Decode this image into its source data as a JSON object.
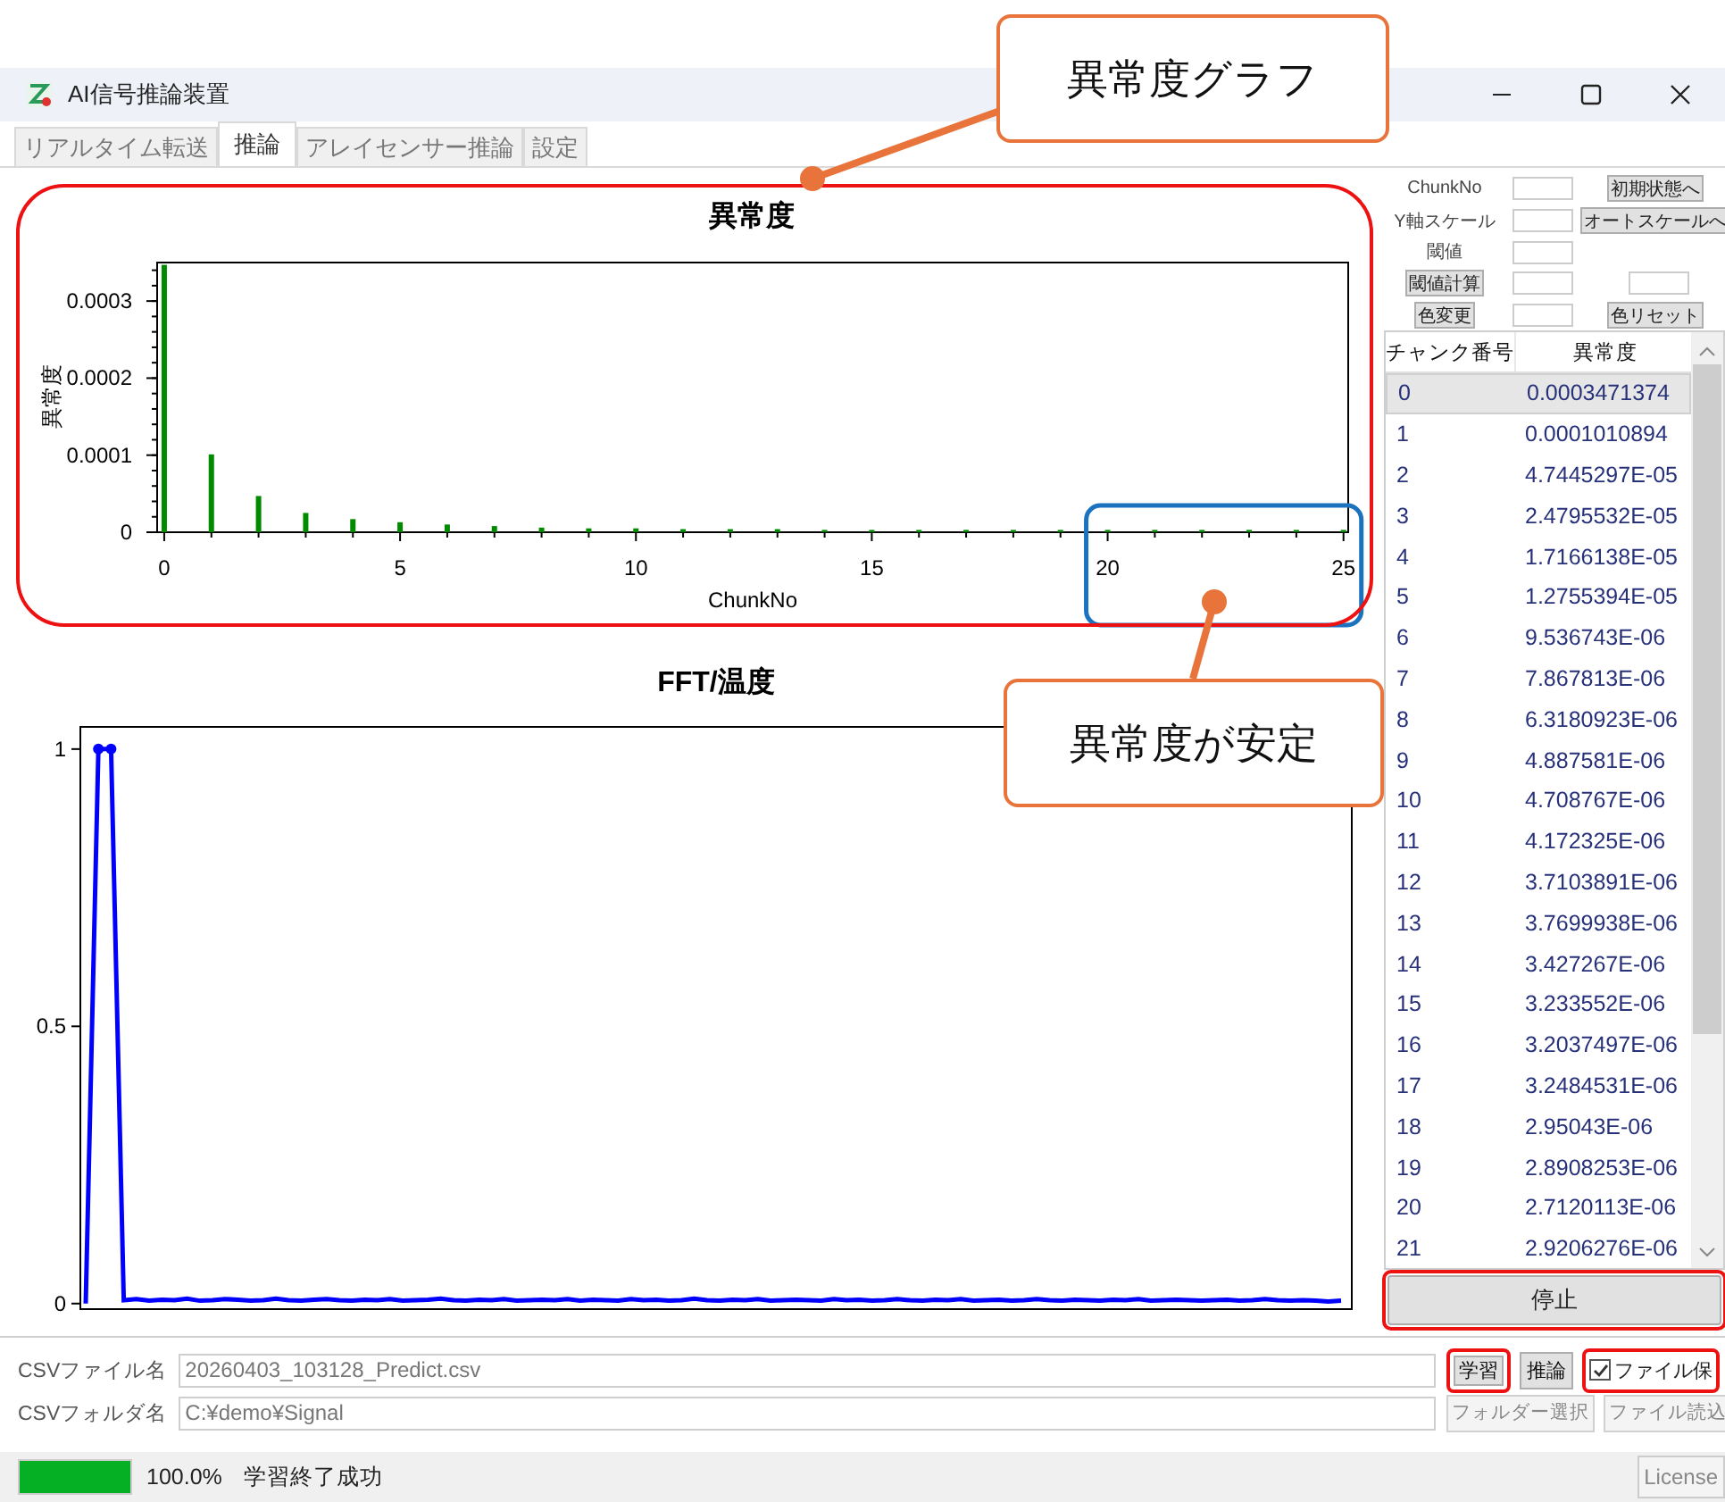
{
  "window": {
    "title": "AI信号推論装置"
  },
  "tabs": [
    {
      "label": "リアルタイム転送",
      "selected": false
    },
    {
      "label": "推論",
      "selected": true
    },
    {
      "label": "アレイセンサー推論",
      "selected": false
    },
    {
      "label": "設定",
      "selected": false
    }
  ],
  "anomaly_chart": {
    "highlighted": true,
    "range_highlighted": true,
    "chart_data": {
      "type": "bar",
      "title": "異常度",
      "xlabel": "ChunkNo",
      "ylabel": "異常度",
      "x": [
        0,
        1,
        2,
        3,
        4,
        5,
        6,
        7,
        8,
        9,
        10,
        11,
        12,
        13,
        14,
        15,
        16,
        17,
        18,
        19,
        20,
        21,
        22,
        23,
        24,
        25
      ],
      "series": [
        {
          "color": "#008a00",
          "values": [
            0.000347,
            0.000101,
            4.7e-05,
            2.5e-05,
            1.7e-05,
            1.3e-05,
            1e-05,
            8e-06,
            6e-06,
            5e-06,
            5e-06,
            4e-06,
            4e-06,
            4e-06,
            3e-06,
            3e-06,
            3e-06,
            3e-06,
            3e-06,
            3e-06,
            3e-06,
            3e-06,
            3e-06,
            3e-06,
            3e-06,
            3e-06
          ]
        }
      ],
      "xlim": [
        -0.15,
        25.1
      ],
      "ylim": [
        0,
        0.00035
      ],
      "xticks": [
        0,
        5,
        10,
        15,
        20,
        25
      ],
      "yticks": [
        0,
        0.0001,
        0.0002,
        0.0003
      ]
    }
  },
  "fft_chart": {
    "chart_data": {
      "type": "line",
      "title": "FFT/温度",
      "ylim": [
        -0.01,
        1.04
      ],
      "yticks": [
        0,
        0.5,
        1
      ],
      "series": [
        {
          "color": "#0000ff",
          "values": [
            0,
            1,
            1,
            0.006,
            0.008,
            0.005,
            0.007,
            0.006,
            0.009,
            0.005,
            0.006,
            0.008,
            0.007,
            0.005,
            0.006,
            0.009,
            0.006,
            0.005,
            0.007,
            0.008,
            0.006,
            0.005,
            0.007,
            0.006,
            0.008,
            0.005,
            0.006,
            0.007,
            0.009,
            0.006,
            0.005,
            0.007,
            0.006,
            0.008,
            0.005,
            0.006,
            0.007,
            0.006,
            0.008,
            0.005,
            0.007,
            0.006,
            0.005,
            0.008,
            0.006,
            0.007,
            0.005,
            0.006,
            0.009,
            0.006,
            0.005,
            0.007,
            0.006,
            0.008,
            0.005,
            0.006,
            0.007,
            0.006,
            0.005,
            0.008,
            0.006,
            0.007,
            0.005,
            0.006,
            0.008,
            0.006,
            0.005,
            0.007,
            0.006,
            0.008,
            0.005,
            0.006,
            0.007,
            0.005,
            0.006,
            0.008,
            0.006,
            0.005,
            0.007,
            0.006,
            0.005,
            0.007,
            0.006,
            0.008,
            0.005,
            0.006,
            0.007,
            0.006,
            0.005,
            0.006,
            0.007,
            0.005,
            0.006,
            0.008,
            0.006,
            0.005,
            0.006,
            0.005,
            0.004,
            0.005
          ]
        }
      ]
    }
  },
  "controls": [
    {
      "cells": [
        {
          "kind": "label",
          "text": "ChunkNo"
        },
        {
          "kind": "input"
        },
        {
          "kind": "button",
          "text": "初期状態へ"
        }
      ]
    },
    {
      "cells": [
        {
          "kind": "label",
          "text": "Y軸スケール"
        },
        {
          "kind": "input"
        },
        {
          "kind": "button",
          "text": "オートスケールへ"
        }
      ]
    },
    {
      "cells": [
        {
          "kind": "label",
          "text": "閾値"
        },
        {
          "kind": "input"
        }
      ]
    },
    {
      "cells": [
        {
          "kind": "button",
          "text": "閾値計算"
        },
        {
          "kind": "input"
        },
        {
          "kind": "input"
        }
      ]
    },
    {
      "cells": [
        {
          "kind": "button",
          "text": "色変更"
        },
        {
          "kind": "input"
        },
        {
          "kind": "button",
          "text": "色リセット"
        }
      ]
    }
  ],
  "table": {
    "columns": [
      "チャンク番号",
      "異常度"
    ],
    "rows": [
      {
        "cells": [
          "0",
          "0.0003471374"
        ],
        "selected": true
      },
      {
        "cells": [
          "1",
          "0.0001010894"
        ],
        "selected": false
      },
      {
        "cells": [
          "2",
          "4.7445297E-05"
        ],
        "selected": false
      },
      {
        "cells": [
          "3",
          "2.4795532E-05"
        ],
        "selected": false
      },
      {
        "cells": [
          "4",
          "1.7166138E-05"
        ],
        "selected": false
      },
      {
        "cells": [
          "5",
          "1.2755394E-05"
        ],
        "selected": false
      },
      {
        "cells": [
          "6",
          "9.536743E-06"
        ],
        "selected": false
      },
      {
        "cells": [
          "7",
          "7.867813E-06"
        ],
        "selected": false
      },
      {
        "cells": [
          "8",
          "6.3180923E-06"
        ],
        "selected": false
      },
      {
        "cells": [
          "9",
          "4.887581E-06"
        ],
        "selected": false
      },
      {
        "cells": [
          "10",
          "4.708767E-06"
        ],
        "selected": false
      },
      {
        "cells": [
          "11",
          "4.172325E-06"
        ],
        "selected": false
      },
      {
        "cells": [
          "12",
          "3.7103891E-06"
        ],
        "selected": false
      },
      {
        "cells": [
          "13",
          "3.7699938E-06"
        ],
        "selected": false
      },
      {
        "cells": [
          "14",
          "3.427267E-06"
        ],
        "selected": false
      },
      {
        "cells": [
          "15",
          "3.233552E-06"
        ],
        "selected": false
      },
      {
        "cells": [
          "16",
          "3.2037497E-06"
        ],
        "selected": false
      },
      {
        "cells": [
          "17",
          "3.2484531E-06"
        ],
        "selected": false
      },
      {
        "cells": [
          "18",
          "2.95043E-06"
        ],
        "selected": false
      },
      {
        "cells": [
          "19",
          "2.8908253E-06"
        ],
        "selected": false
      },
      {
        "cells": [
          "20",
          "2.7120113E-06"
        ],
        "selected": false
      },
      {
        "cells": [
          "21",
          "2.9206276E-06"
        ],
        "selected": false
      }
    ]
  },
  "stop_button": {
    "label": "停止",
    "highlighted": true
  },
  "file_row": {
    "label": "CSVファイル名",
    "value": "20260403_103128_Predict.csv",
    "buttons": [
      {
        "label": "学習",
        "highlighted": true
      },
      {
        "label": "推論",
        "highlighted": false
      }
    ],
    "checkbox": {
      "label": "ファイル保",
      "checked": true,
      "highlighted": true
    }
  },
  "folder_row": {
    "label": "CSVフォルダ名",
    "value": "C:¥demo¥Signal",
    "buttons": [
      {
        "label": "フォルダー選択",
        "disabled": true
      },
      {
        "label": "ファイル読込",
        "disabled": true
      }
    ]
  },
  "status_bar": {
    "progress": {
      "level": 1
    },
    "percent": "100.0%",
    "message": "学習終了成功",
    "license_button": "License"
  },
  "callouts": [
    {
      "text": "異常度グラフ"
    },
    {
      "text": "異常度が安定"
    }
  ]
}
